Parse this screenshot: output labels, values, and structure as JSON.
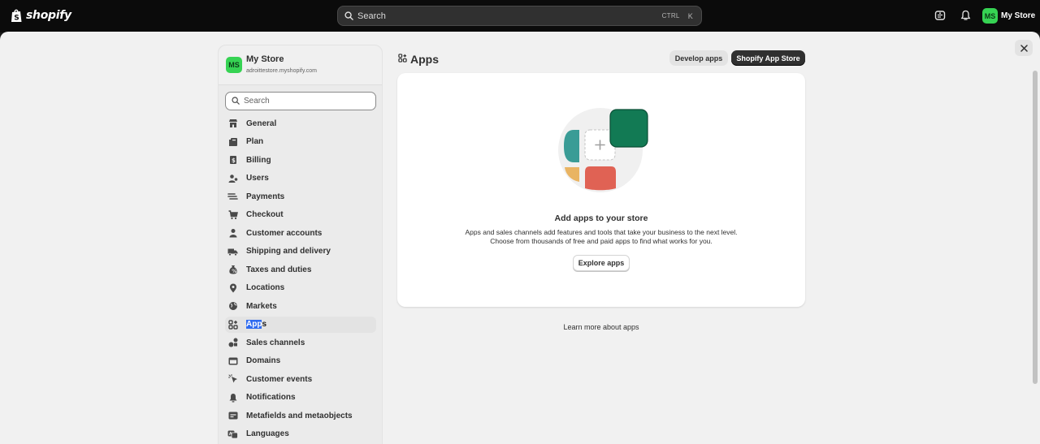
{
  "topbar": {
    "brand": "shopify",
    "search_label": "Search",
    "shortcut_ctrl": "CTRL",
    "shortcut_key": "K",
    "avatar_initials": "MS",
    "store_name": "My Store"
  },
  "sidebar": {
    "avatar_initials": "MS",
    "store_name": "My Store",
    "store_domain": "adroittestore.myshopify.com",
    "search_placeholder": "Search",
    "items": [
      {
        "label": "General",
        "icon": "store-icon"
      },
      {
        "label": "Plan",
        "icon": "plan-icon"
      },
      {
        "label": "Billing",
        "icon": "billing-icon"
      },
      {
        "label": "Users",
        "icon": "users-icon"
      },
      {
        "label": "Payments",
        "icon": "payments-icon"
      },
      {
        "label": "Checkout",
        "icon": "cart-icon"
      },
      {
        "label": "Customer accounts",
        "icon": "person-icon"
      },
      {
        "label": "Shipping and delivery",
        "icon": "truck-icon"
      },
      {
        "label": "Taxes and duties",
        "icon": "tax-icon"
      },
      {
        "label": "Locations",
        "icon": "location-icon"
      },
      {
        "label": "Markets",
        "icon": "globe-icon"
      },
      {
        "label": "Apps",
        "icon": "apps-icon",
        "active": true,
        "selected_text": "App",
        "rest_text": "s"
      },
      {
        "label": "Sales channels",
        "icon": "channels-icon"
      },
      {
        "label": "Domains",
        "icon": "domains-icon"
      },
      {
        "label": "Customer events",
        "icon": "cursor-icon"
      },
      {
        "label": "Notifications",
        "icon": "bell-icon"
      },
      {
        "label": "Metafields and metaobjects",
        "icon": "metafields-icon"
      },
      {
        "label": "Languages",
        "icon": "languages-icon"
      }
    ]
  },
  "content": {
    "title": "Apps",
    "develop_apps": "Develop apps",
    "app_store": "Shopify App Store",
    "card_title": "Add apps to your store",
    "card_desc_line1": "Apps and sales channels add features and tools that take your business to the next level.",
    "card_desc_line2": "Choose from thousands of free and paid apps to find what works for you.",
    "explore_button": "Explore apps",
    "learn_more": "Learn more about apps"
  },
  "colors": {
    "topbar_bg": "#0b0b0b",
    "panel_bg": "#f1f1f1",
    "avatar_green": "#36d353",
    "tile_green": "#127a54",
    "tile_teal": "#3a9c96",
    "tile_red": "#e06254",
    "tile_yellow": "#e9b463",
    "selection_blue": "#2f6bf0"
  }
}
